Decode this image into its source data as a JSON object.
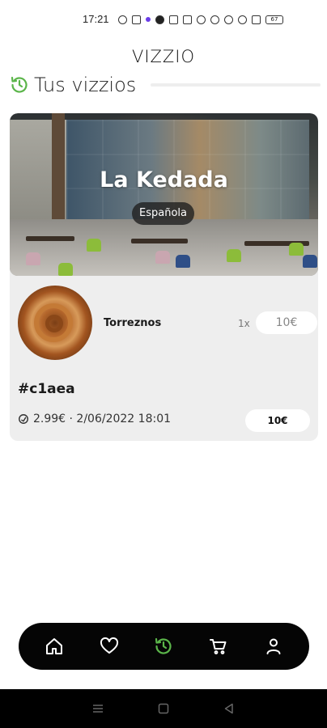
{
  "status_bar": {
    "time": "17:21",
    "battery": "67"
  },
  "app": {
    "title": "VIZZIO"
  },
  "section": {
    "title": "Tus vizzios",
    "icon": "history-icon",
    "accent_color": "#5bb54a"
  },
  "order": {
    "restaurant_name": "La Kedada",
    "cuisine": "Española",
    "items": [
      {
        "name": "Torreznos",
        "quantity": "1x",
        "price": "10€"
      }
    ],
    "code": "#c1aea",
    "meta": "2.99€ · 2/06/2022 18:01",
    "total": "10€"
  },
  "bottom_nav": {
    "items": [
      {
        "icon": "home-icon",
        "active": false
      },
      {
        "icon": "heart-icon",
        "active": false
      },
      {
        "icon": "history-icon",
        "active": true
      },
      {
        "icon": "cart-icon",
        "active": false
      },
      {
        "icon": "user-icon",
        "active": false
      }
    ],
    "active_color": "#5bb54a"
  }
}
